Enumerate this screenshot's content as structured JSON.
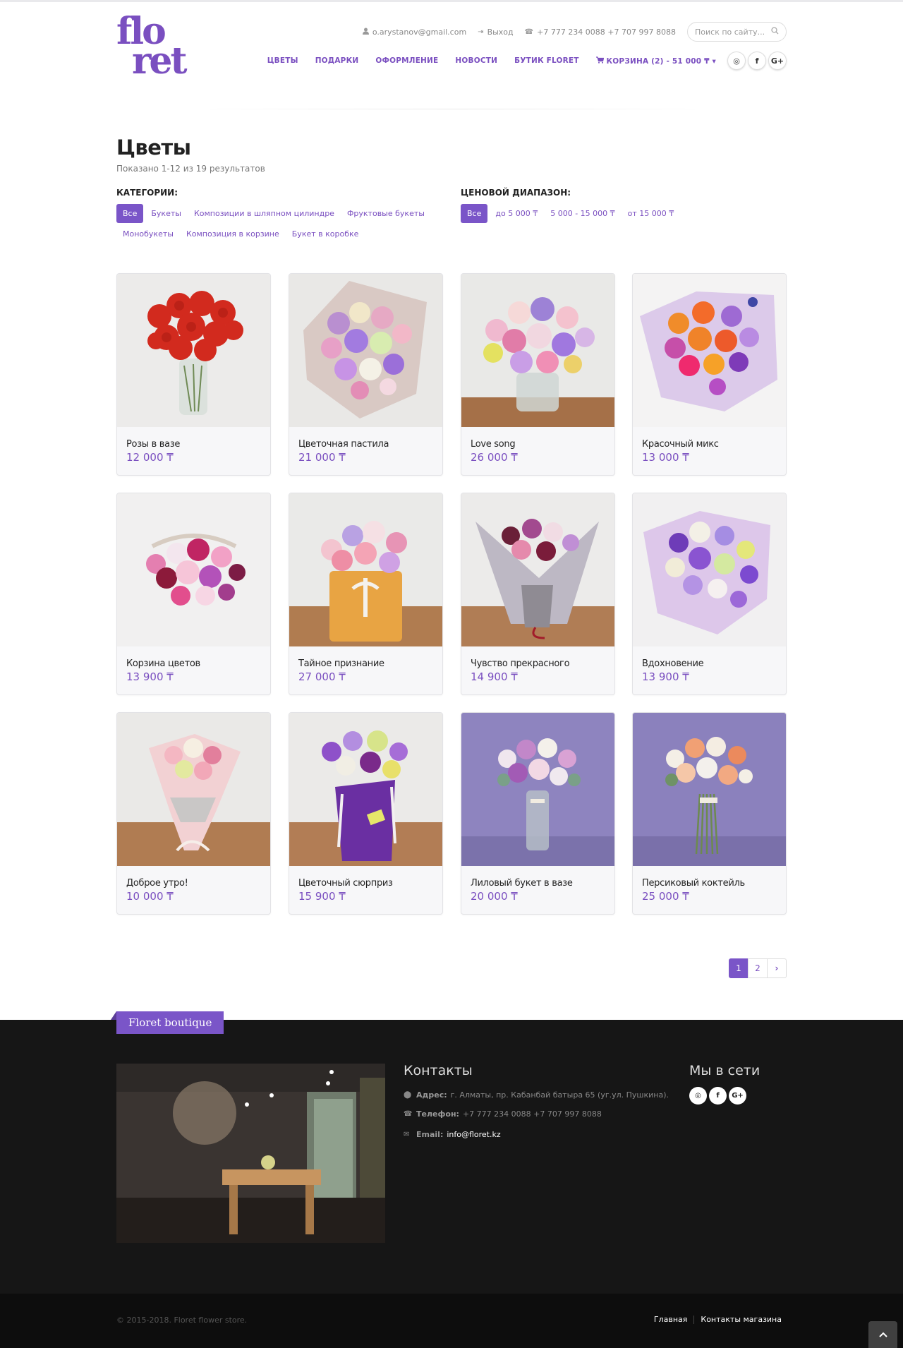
{
  "header": {
    "logo_top": "flo",
    "logo_bottom": "ret",
    "email": "o.arystanov@gmail.com",
    "logout": "Выход",
    "phones": "+7 777 234 0088 +7 707 997 8088",
    "search_placeholder": "Поиск по сайту..."
  },
  "nav": {
    "items": [
      "Цветы",
      "Подарки",
      "Оформление",
      "Новости",
      "Бутик Floret"
    ],
    "cart": "Корзина (2) - 51 000 ₸"
  },
  "social": [
    "instagram-icon",
    "facebook-icon",
    "google-plus-icon"
  ],
  "page": {
    "title": "Цветы",
    "results": "Показано 1-12 из 19 результатов"
  },
  "categories": {
    "heading": "Категории:",
    "row1": [
      "Все",
      "Букеты",
      "Композиции в шляпном цилиндре",
      "Фруктовые букеты"
    ],
    "row2": [
      "Монобукеты",
      "Композиция в корзине",
      "Букет в коробке"
    ],
    "active": "Все"
  },
  "price": {
    "heading": "Ценовой диапазон:",
    "items": [
      "Все",
      "до 5 000 ₸",
      "5 000 - 15 000 ₸",
      "от 15 000 ₸"
    ],
    "active": "Все"
  },
  "products": [
    {
      "name": "Розы в вазе",
      "price": "12 000 ₸"
    },
    {
      "name": "Цветочная пастила",
      "price": "21 000 ₸"
    },
    {
      "name": "Love song",
      "price": "26 000 ₸"
    },
    {
      "name": "Красочный микс",
      "price": "13 000 ₸"
    },
    {
      "name": "Корзина цветов",
      "price": "13 900 ₸"
    },
    {
      "name": "Тайное признание",
      "price": "27 000 ₸"
    },
    {
      "name": "Чувство прекрасного",
      "price": "14 900 ₸"
    },
    {
      "name": "Вдохновение",
      "price": "13 900 ₸"
    },
    {
      "name": "Доброе утро!",
      "price": "10 000 ₸"
    },
    {
      "name": "Цветочный сюрприз",
      "price": "15 900 ₸"
    },
    {
      "name": "Лиловый букет в вазе",
      "price": "20 000 ₸"
    },
    {
      "name": "Персиковый коктейль",
      "price": "25 000 ₸"
    }
  ],
  "pagination": {
    "pages": [
      "1",
      "2"
    ],
    "current": "1",
    "next": "›"
  },
  "footer": {
    "ribbon": "Floret boutique",
    "contacts_heading": "Контакты",
    "address_label": "Адрес:",
    "address": "г. Алматы, пр. Кабанбай батыра 65 (уг.ул. Пушкина).",
    "phone_label": "Телефон:",
    "phone": "+7 777 234 0088 +7 707 997 8088",
    "email_label": "Email:",
    "email": "info@floret.kz",
    "social_heading": "Мы в сети",
    "copyright": "© 2015-2018. Floret flower store.",
    "links": [
      "Главная",
      "Контакты магазина"
    ]
  },
  "colors": {
    "accent": "#7a55c8",
    "footer_bg": "#161616"
  }
}
